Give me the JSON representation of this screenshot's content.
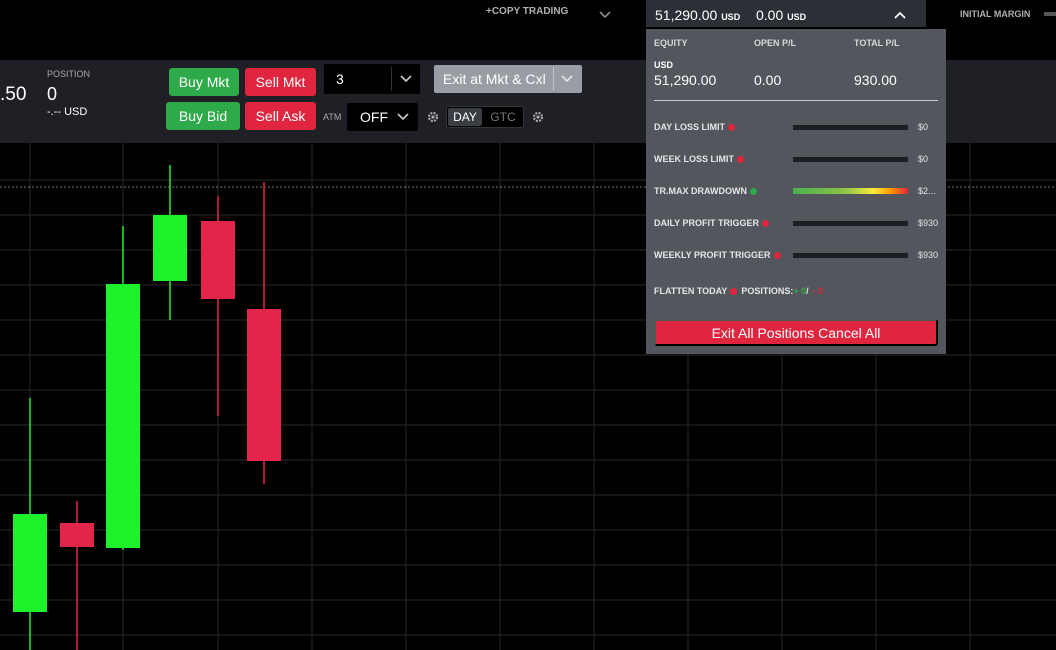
{
  "topbar": {
    "copy_trading": "+COPY TRADING",
    "account_equity": "51,290.00",
    "account_equity_unit": "USD",
    "account_open_pl": "0.00",
    "account_open_pl_unit": "USD",
    "initial_margin_label": "INITIAL MARGIN"
  },
  "toolbar": {
    "price_fragment": ".50",
    "position_label": "POSITION",
    "position_value": "0",
    "position_usd": "-.-- USD",
    "buy_mkt": "Buy Mkt",
    "sell_mkt": "Sell Mkt",
    "buy_bid": "Buy Bid",
    "sell_ask": "Sell Ask",
    "quantity": "3",
    "exit_button": "Exit at Mkt & Cxl",
    "atm_label": "ATM",
    "atm_value": "OFF",
    "tif_day": "DAY",
    "tif_gtc": "GTC"
  },
  "risk_panel": {
    "equity_label": "EQUITY",
    "open_pl_label": "OPEN P/L",
    "total_pl_label": "TOTAL P/L",
    "currency": "USD",
    "equity_value": "51,290.00",
    "open_pl_value": "0.00",
    "total_pl_value": "930.00",
    "rows": [
      {
        "label": "DAY LOSS LIMIT",
        "value": "$0"
      },
      {
        "label": "WEEK LOSS LIMIT",
        "value": "$0"
      },
      {
        "label": "TR.MAX DRAWDOWN",
        "value": "$2..."
      },
      {
        "label": "DAILY PROFIT TRIGGER",
        "value": "$930"
      },
      {
        "label": "WEEKLY PROFIT TRIGGER",
        "value": "$930"
      }
    ],
    "flatten_today": "FLATTEN TODAY",
    "positions_label": "POSITIONS:",
    "positions_plus": "+ 0",
    "positions_sep": "/",
    "positions_minus": "- 0",
    "exit_all": "Exit All Positions Cancel All"
  },
  "colors": {
    "bull": "#1ff12b",
    "bear": "#e3254a",
    "buy": "#2eaa4a",
    "sell": "#e0253f"
  },
  "chart_candles": [
    {
      "direction": "up"
    },
    {
      "direction": "down"
    },
    {
      "direction": "up"
    },
    {
      "direction": "up"
    },
    {
      "direction": "down"
    },
    {
      "direction": "down"
    }
  ]
}
